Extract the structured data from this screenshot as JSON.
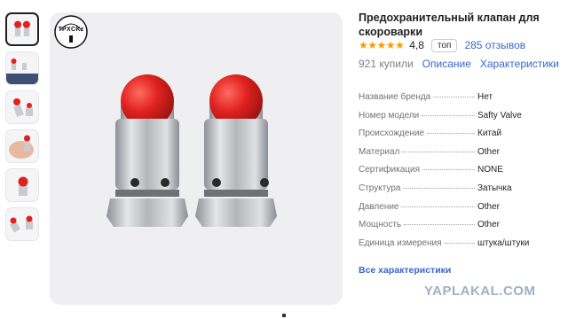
{
  "product": {
    "title": "Предохранительный клапан для скороварки",
    "rating": "4,8",
    "stars": "★★★★★",
    "top_badge": "топ",
    "reviews": "285 отзывов",
    "bought": "921 купили",
    "description_link": "Описание",
    "characteristics_link": "Характеристики"
  },
  "gallery": {
    "logo_text": "TPXCKz",
    "thumbnail_count": 6,
    "selected_index": 0
  },
  "specs": [
    {
      "key": "Название бренда",
      "value": "Нет"
    },
    {
      "key": "Номер модели",
      "value": "Safty Valve"
    },
    {
      "key": "Происхождение",
      "value": "Китай"
    },
    {
      "key": "Материал",
      "value": "Other"
    },
    {
      "key": "Сертификация",
      "value": "NONE"
    },
    {
      "key": "Структура",
      "value": "Затычка"
    },
    {
      "key": "Давление",
      "value": "Other"
    },
    {
      "key": "Мощность",
      "value": "Other"
    },
    {
      "key": "Единица измерения",
      "value": "штука/штуки"
    }
  ],
  "all_specs_link": "Все характеристики",
  "watermark": "YAPLAKAL.COM",
  "colors": {
    "accent_link": "#3a66cc",
    "star": "#ff9900",
    "valve_red": "#e0221f"
  }
}
